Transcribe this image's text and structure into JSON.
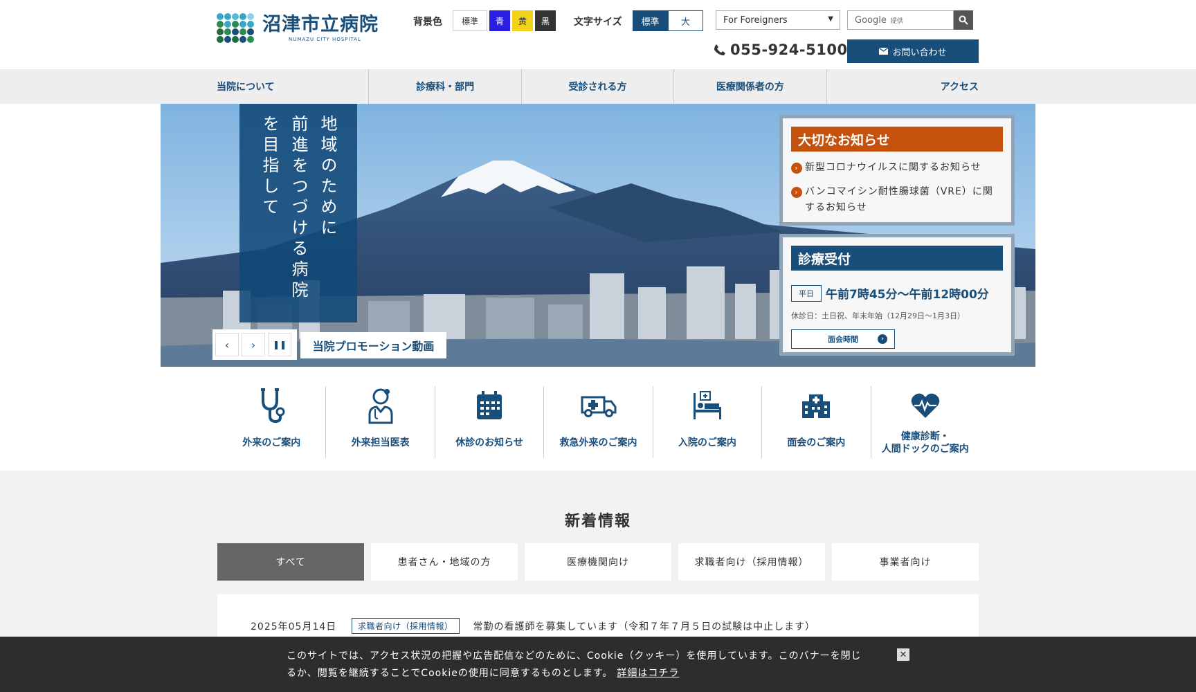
{
  "header": {
    "logo_jp": "沼津市立病院",
    "logo_en": "NUMAZU CITY HOSPITAL",
    "bg_color_label": "背景色",
    "bg_options": [
      "標準",
      "青",
      "黄",
      "黒"
    ],
    "font_size_label": "文字サイズ",
    "font_size_options": [
      "標準",
      "大"
    ],
    "language_select": "For Foreigners",
    "search_brand": "Google",
    "search_sub": "提供",
    "phone": "055-924-5100",
    "contact_label": "お問い合わせ"
  },
  "nav": {
    "items": [
      "当院について",
      "診療科・部門",
      "受診される方",
      "医療関係者の方",
      "アクセス"
    ]
  },
  "hero": {
    "catch_lines": [
      "地域のために",
      "前進をつづける病院",
      "を目指して"
    ],
    "promo_label": "当院プロモーション動画",
    "notice": {
      "title": "大切なお知らせ",
      "items": [
        "新型コロナウイルスに関するお知らせ",
        "バンコマイシン耐性腸球菌（VRE）に関するお知らせ"
      ]
    },
    "hours": {
      "title": "診療受付",
      "badge": "平日",
      "time": "午前7時45分～午前12時00分",
      "note": "休診日：土日祝、年末年始（12月29日～1月3日）",
      "visit_label": "面会時間"
    }
  },
  "quick_links": {
    "items": [
      "外来のご案内",
      "外来担当医表",
      "休診のお知らせ",
      "救急外来のご案内",
      "入院のご案内",
      "面会のご案内",
      "健康診断・\n人間ドックのご案内"
    ]
  },
  "news": {
    "title": "新着情報",
    "tabs": [
      "すべて",
      "患者さん・地域の方",
      "医療機関向け",
      "求職者向け（採用情報）",
      "事業者向け"
    ],
    "items": [
      {
        "date": "2025年05月14日",
        "category": "求職者向け（採用情報）",
        "text": "常勤の看護師を募集しています（令和７年７月５日の試験は中止します）"
      }
    ]
  },
  "cookie": {
    "text": "このサイトでは、アクセス状況の把握や広告配信などのために、Cookie（クッキー）を使用しています。このバナーを閉じるか、閲覧を継続することでCookieの使用に同意するものとします。",
    "link": "詳細はコチラ"
  },
  "colors": {
    "brand": "#1a4e7a",
    "notice_head": "#c4520c",
    "nav_bg": "#eeeeee",
    "news_bg": "#f2f2f2",
    "bg_blue": "#2a1fe0",
    "bg_yellow": "#f2d21a",
    "bg_black": "#333333"
  },
  "icons": [
    "chevron-left-icon",
    "chevron-right-icon",
    "pause-icon",
    "phone-icon",
    "mail-icon",
    "search-icon",
    "stethoscope-icon",
    "doctor-icon",
    "calendar-icon",
    "ambulance-icon",
    "hospital-bed-icon",
    "hospital-building-icon",
    "heart-pulse-icon",
    "close-icon"
  ]
}
